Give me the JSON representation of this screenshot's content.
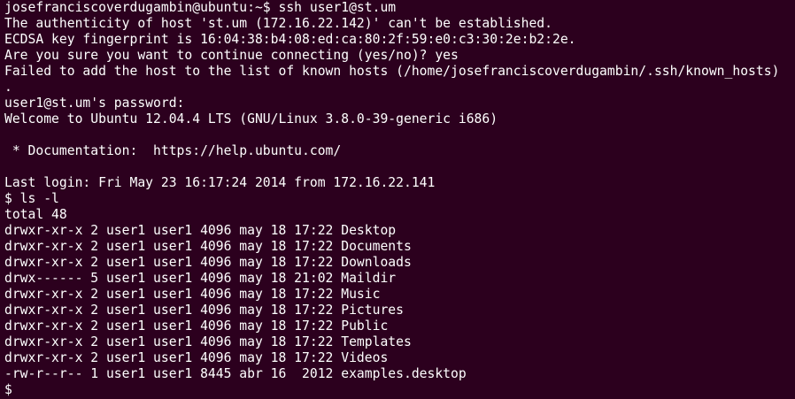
{
  "terminal": {
    "lines": [
      "josefranciscoverdugambin@ubuntu:~$ ssh user1@st.um",
      "The authenticity of host 'st.um (172.16.22.142)' can't be established.",
      "ECDSA key fingerprint is 16:04:38:b4:08:ed:ca:80:2f:59:e0:c3:30:2e:b2:2e.",
      "Are you sure you want to continue connecting (yes/no)? yes",
      "Failed to add the host to the list of known hosts (/home/josefranciscoverdugambin/.ssh/known_hosts)",
      ".",
      "user1@st.um's password:",
      "Welcome to Ubuntu 12.04.4 LTS (GNU/Linux 3.8.0-39-generic i686)",
      "",
      " * Documentation:  https://help.ubuntu.com/",
      "",
      "Last login: Fri May 23 16:17:24 2014 from 172.16.22.141",
      "$ ls -l",
      "total 48",
      "drwxr-xr-x 2 user1 user1 4096 may 18 17:22 Desktop",
      "drwxr-xr-x 2 user1 user1 4096 may 18 17:22 Documents",
      "drwxr-xr-x 2 user1 user1 4096 may 18 17:22 Downloads",
      "drwx------ 5 user1 user1 4096 may 18 21:02 Maildir",
      "drwxr-xr-x 2 user1 user1 4096 may 18 17:22 Music",
      "drwxr-xr-x 2 user1 user1 4096 may 18 17:22 Pictures",
      "drwxr-xr-x 2 user1 user1 4096 may 18 17:22 Public",
      "drwxr-xr-x 2 user1 user1 4096 may 18 17:22 Templates",
      "drwxr-xr-x 2 user1 user1 4096 may 18 17:22 Videos",
      "-rw-r--r-- 1 user1 user1 8445 abr 16  2012 examples.desktop"
    ],
    "prompt": "$",
    "colors": {
      "background": "#2c001e",
      "text": "#ffffff"
    }
  }
}
